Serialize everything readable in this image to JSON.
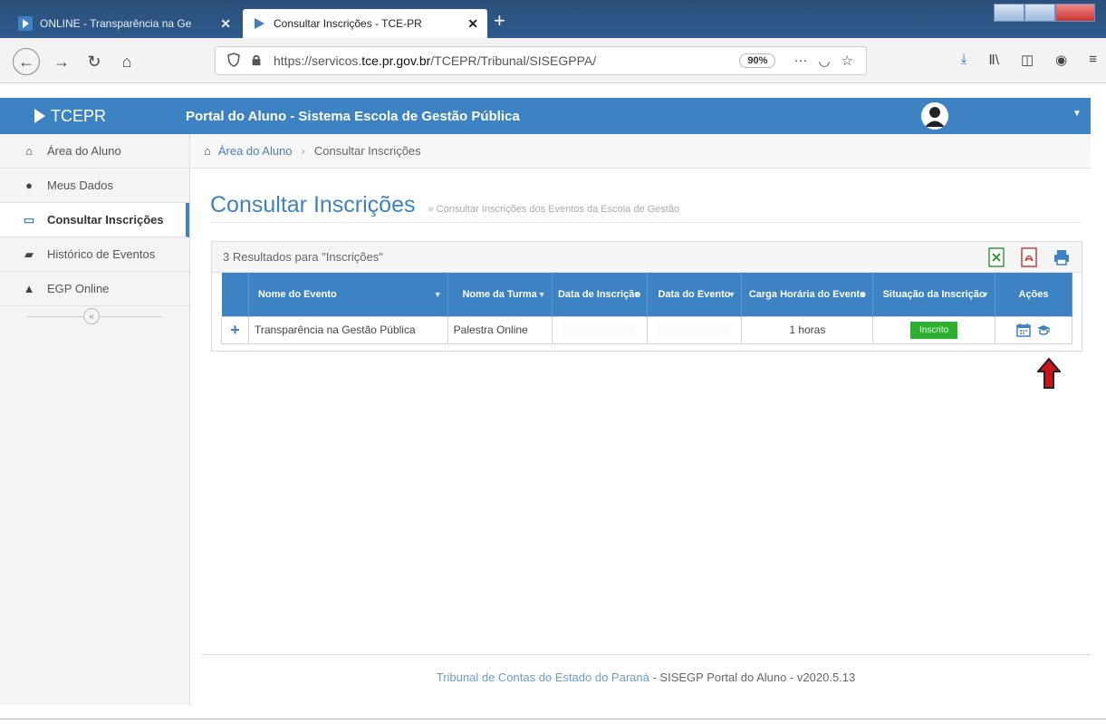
{
  "browser": {
    "tabs": [
      {
        "label": "ONLINE - Transparência na Ge"
      },
      {
        "label": "Consultar Inscrições - TCE-PR"
      }
    ],
    "url_prefix": "https://servicos.",
    "url_domain": "tce.pr.gov.br",
    "url_path": "/TCEPR/Tribunal/SISEGPPA/",
    "zoom": "90%"
  },
  "header": {
    "logo": "TCEPR",
    "title": "Portal do Aluno - Sistema Escola de Gestão Pública"
  },
  "sidebar": {
    "items": [
      {
        "label": "Área do Aluno",
        "icon": "home-icon"
      },
      {
        "label": "Meus Dados",
        "icon": "user-icon"
      },
      {
        "label": "Consultar Inscrições",
        "icon": "laptop-icon",
        "active": true
      },
      {
        "label": "Histórico de Eventos",
        "icon": "history-icon"
      },
      {
        "label": "EGP Online",
        "icon": "graduation-cap-icon"
      }
    ]
  },
  "breadcrumb": {
    "home": "Área do Aluno",
    "current": "Consultar Inscrições"
  },
  "page": {
    "title": "Consultar Inscrições",
    "subtitle": "» Consultar Inscrições dos Eventos da Escola de Gestão"
  },
  "results": {
    "summary": "3 Resultados para \"Inscrições\"",
    "columns": [
      "Nome do Evento",
      "Nome da Turma",
      "Data de Inscrição",
      "Data do Evento",
      "Carga Horária do Evento",
      "Situação da Inscrição",
      "Ações"
    ],
    "rows": [
      {
        "evento": "Transparência na Gestão Pública",
        "turma": "Palestra Online",
        "data_inscricao": "",
        "data_evento": "",
        "carga": "1 horas",
        "situacao": "Inscrito"
      }
    ]
  },
  "footer": {
    "org": "Tribunal de Contas do Estado do Paraná",
    "rest": " - SISEGP Portal do Aluno - v2020.5.13"
  },
  "colors": {
    "accent": "#3d82c2",
    "status_ok": "#2db02d",
    "arrow": "#c8151b"
  }
}
